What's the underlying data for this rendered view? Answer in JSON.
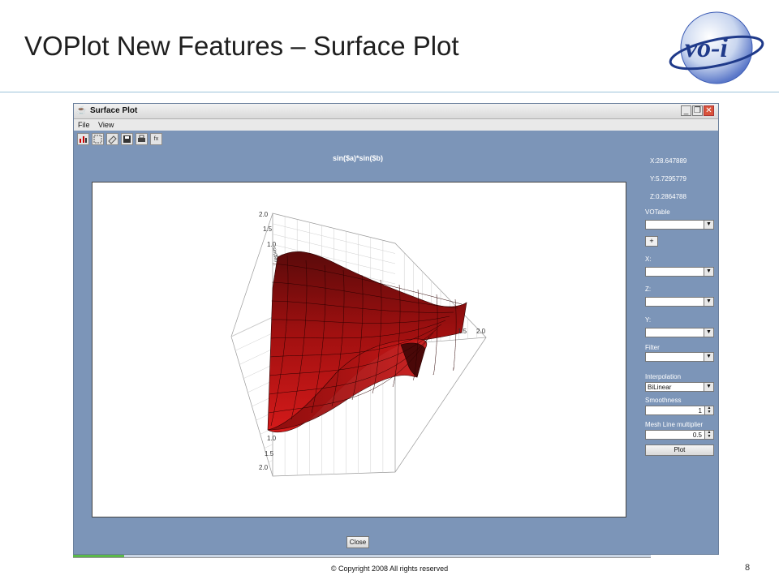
{
  "slide": {
    "title": "VOPlot New Features – Surface Plot",
    "footer": "© Copyright 2008 All rights reserved",
    "page_number": "8",
    "logo_text": "vo-i"
  },
  "window": {
    "title": "Surface Plot",
    "menu": [
      "File",
      "View"
    ],
    "toolbar_icons": [
      "plot-icon",
      "zoom-icon",
      "eraser-icon",
      "save-icon",
      "print-icon",
      "fx-icon"
    ],
    "fx_label": "fx",
    "minimize_glyph": "_",
    "restore_glyph": "❐",
    "close_glyph": "✕"
  },
  "plot": {
    "title": "sin($a)*sin($b)",
    "axis_ticks": [
      "2.0",
      "1.5",
      "1.0",
      "1.0",
      "1.5",
      "2.0",
      "1.5",
      "2.0"
    ],
    "axis_label_fragment": "sin($a)"
  },
  "side_panel": {
    "x_readout": "X:28.647889",
    "y_readout": "Y:5.7295779",
    "z_readout": "Z:0.2864788",
    "votable_label": "VOTable",
    "votable_value": "",
    "add_label": "+",
    "x_label": "X:",
    "x_value": "",
    "z_label": "Z:",
    "z_value": "",
    "y_label": "Y:",
    "y_value": "",
    "filter_label": "Filter",
    "filter_value": "",
    "interpolation_label": "Interpolation",
    "interpolation_value": "BiLinear",
    "smoothness_label": "Smoothness",
    "smoothness_value": "1",
    "mesh_label": "Mesh Line multiplier",
    "mesh_value": "0.5",
    "plot_button": "Plot"
  },
  "close_button": "Close",
  "colors": {
    "window_bg": "#7c95b8",
    "surface_dark": "#5a0a0a",
    "surface_bright": "#d41a1a",
    "logo_blue": "#1f3a8a"
  }
}
